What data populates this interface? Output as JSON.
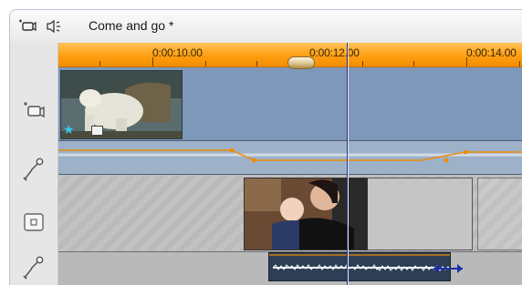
{
  "title": "Come and go *",
  "ruler": {
    "labels": [
      "0:00:10.00",
      "0:00:12.00",
      "0:00:14.00"
    ]
  },
  "tracks": [
    {
      "name": "video-overlay-track",
      "icon": "camcorder-icon"
    },
    {
      "name": "audio-overlay-track",
      "icon": "audio-cable-icon"
    },
    {
      "name": "video-main-track",
      "icon": "box-icon"
    },
    {
      "name": "audio-main-track",
      "icon": "audio-cable-icon"
    }
  ],
  "header_icons": [
    "camcorder-icon",
    "speaker-icon"
  ],
  "colors": {
    "ruler": "#ff9e12",
    "overlay_track": "#7d98b8",
    "volume_line": "#f08a00",
    "playhead": "#2b2f7a",
    "star": "#35c8f0"
  }
}
